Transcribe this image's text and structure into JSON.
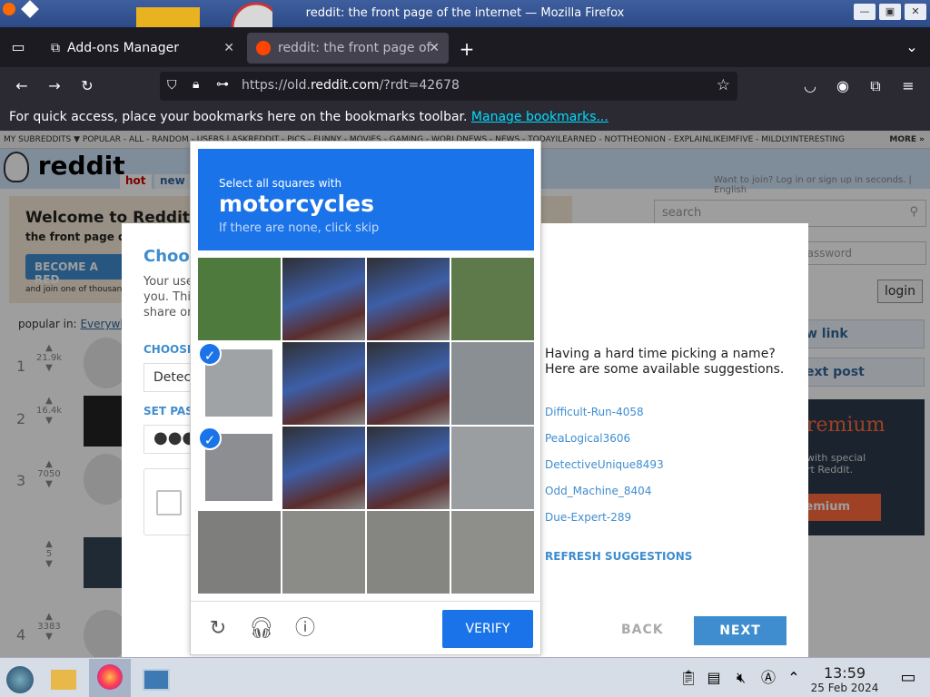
{
  "window": {
    "title": "reddit: the front page of the internet — Mozilla Firefox",
    "min": "—",
    "max": "▣",
    "close": "✕"
  },
  "tabs": [
    {
      "label": "Add-ons Manager",
      "icon": "puzzle-icon"
    },
    {
      "label": "reddit: the front page of",
      "icon": "reddit-icon"
    }
  ],
  "nav": {
    "url_prefix": "https://old.",
    "url_domain": "reddit.com",
    "url_rest": "/?rdt=42678"
  },
  "bookmarks_bar": {
    "text": "For quick access, place your bookmarks here on the bookmarks toolbar.",
    "link": "Manage bookmarks..."
  },
  "reddit": {
    "subreddit_bar": "MY SUBREDDITS ▼   POPULAR - ALL - RANDOM - USERS | ASKREDDIT - PICS - FUNNY - MOVIES - GAMING - WORLDNEWS - NEWS - TODAYILEARNED - NOTTHEONION - EXPLAINLIKEIMFIVE - MILDLYINTERESTING",
    "more": "MORE »",
    "logo": "reddit",
    "tab_hot": "hot",
    "tab_new": "new",
    "login_hint": "Want to join? Log in or sign up in seconds. | English",
    "welcome_title": "Welcome to Reddit,",
    "welcome_sub": "the front page o",
    "become": "BECOME A RED",
    "join_text": "and join one of thousan",
    "popular_in": "popular in:",
    "popular_where": "Everywhe",
    "search": "search",
    "password": "password",
    "login": "login",
    "submit_link": "w link",
    "submit_text": "ext post",
    "premium_title": "remium",
    "premium_desc1": "with special",
    "premium_desc2": "rt Reddit.",
    "premium_btn": "remium",
    "posts": [
      {
        "rank": "1",
        "votes": "21.9k"
      },
      {
        "rank": "2",
        "votes": "16.4k"
      },
      {
        "rank": "3",
        "votes": "7050"
      },
      {
        "rank": "",
        "votes": "5"
      },
      {
        "rank": "4",
        "votes": "3383"
      }
    ]
  },
  "signup": {
    "choose": "Choos",
    "desc": "Your use you. Thi share or",
    "username_label": "CHOOSE",
    "username_value": "Detec",
    "password_label": "SET PAS",
    "password_value": "●●●",
    "hint_line1": "Having a hard time picking a name?",
    "hint_line2": "Here are some available suggestions.",
    "suggestions": [
      "Difficult-Run-4058",
      "PeaLogical3606",
      "DetectiveUnique8493",
      "Odd_Machine_8404",
      "Due-Expert-289"
    ],
    "refresh": "REFRESH SUGGESTIONS",
    "back": "BACK",
    "next": "NEXT"
  },
  "captcha": {
    "line1": "Select all squares with",
    "target": "motorcycles",
    "line3": "If there are none, click skip",
    "verify": "VERIFY",
    "selected_cells": [
      4,
      8
    ]
  },
  "taskbar": {
    "time": "13:59",
    "date": "25 Feb 2024"
  },
  "colors": {
    "captcha_blue": "#1a73e8",
    "reddit_blue": "#3f8dcf",
    "firefox_dark": "#1c1b22"
  }
}
